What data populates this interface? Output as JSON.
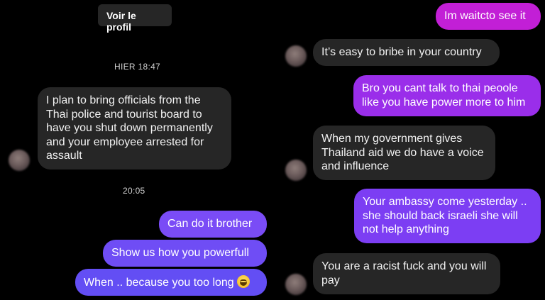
{
  "colors": {
    "background": "#000000",
    "incoming_bubble": "#262626",
    "outgoing_purple": "#8a3ffc",
    "outgoing_magenta": "#c21fd6",
    "outgoing_blue": "#6b4cf6"
  },
  "left": {
    "profile_button": "Voir le profil",
    "timestamp_1": "HIER 18:47",
    "incoming_1": [
      "I plan to bring officials from the",
      "Thai police and tourist board to",
      "have you shut down permanently",
      "and your employee arrested for",
      "assault"
    ],
    "timestamp_2": "20:05",
    "outgoing_1": "Can do it brother",
    "outgoing_2": "Show us how you powerfull",
    "outgoing_3": "When .. because you too long",
    "emoji_icon": "grinning-squinting-face"
  },
  "right": {
    "outgoing_1": "Im waitcto see it",
    "incoming_1": "It’s easy to bribe in your country",
    "outgoing_2": [
      "Bro you cant talk to thai peoole",
      "like you have power more to him"
    ],
    "incoming_2": [
      "When my government gives",
      "Thailand aid we do have a voice",
      "and influence"
    ],
    "outgoing_3": [
      "Your ambassy come yesterday ..",
      "she should back israeli she will",
      "not help anything"
    ],
    "incoming_3": [
      "You are a racist fuck and you will",
      "pay"
    ]
  }
}
